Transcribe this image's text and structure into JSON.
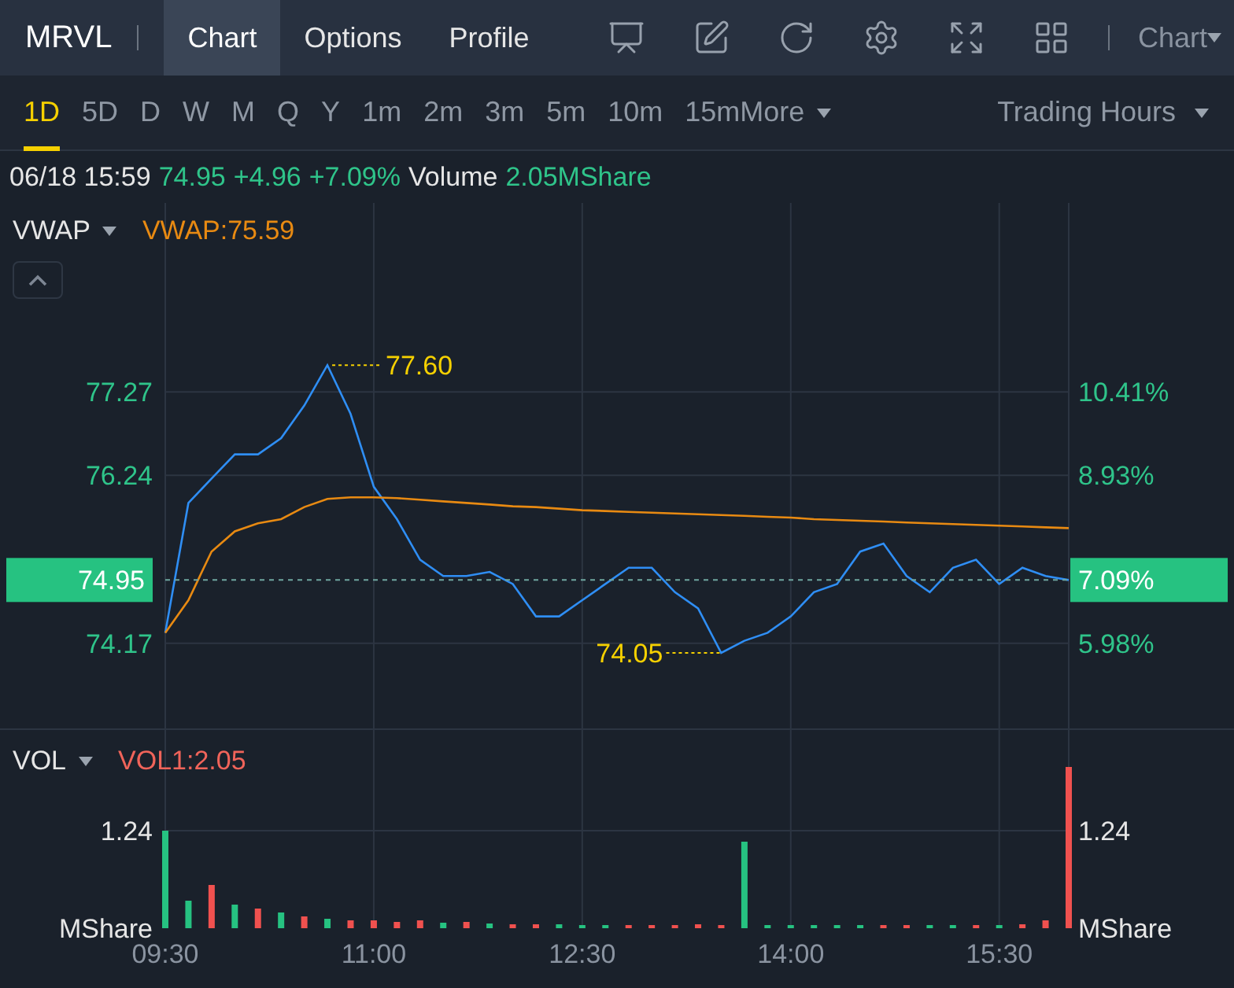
{
  "header": {
    "symbol": "MRVL",
    "tabs": [
      {
        "label": "Chart",
        "selected": true
      },
      {
        "label": "Options",
        "selected": false
      },
      {
        "label": "Profile",
        "selected": false
      }
    ],
    "chart_menu": "Chart"
  },
  "periods": [
    {
      "label": "1D",
      "selected": true
    },
    {
      "label": "5D",
      "selected": false
    },
    {
      "label": "D",
      "selected": false
    },
    {
      "label": "W",
      "selected": false
    },
    {
      "label": "M",
      "selected": false
    },
    {
      "label": "Q",
      "selected": false
    },
    {
      "label": "Y",
      "selected": false
    },
    {
      "label": "1m",
      "selected": false
    },
    {
      "label": "2m",
      "selected": false
    },
    {
      "label": "3m",
      "selected": false
    },
    {
      "label": "5m",
      "selected": false
    },
    {
      "label": "10m",
      "selected": false
    },
    {
      "label": "15m",
      "selected": false
    }
  ],
  "more": "More",
  "session": "Trading Hours",
  "quote": {
    "time": "06/18 15:59",
    "price": "74.95",
    "change": "+4.96",
    "change_pct": "+7.09%",
    "volume_label": "Volume",
    "volume": "2.05MShare"
  },
  "price_panel": {
    "indicator": "VWAP",
    "indicator_value": "VWAP:75.59",
    "last_price": {
      "percent": "7.09%"
    },
    "percent_ticks": [
      "10.41%",
      "8.93%",
      "5.98%"
    ],
    "chart_data": {
      "type": "line",
      "grid": true,
      "ref_lines": [
        {
          "axis": "y",
          "value": 74.95,
          "label": "74.95"
        }
      ],
      "ylim": [
        73.1,
        79.6
      ],
      "yticks": [
        {
          "value": 77.27,
          "label": "77.27"
        },
        {
          "value": 76.24,
          "label": "76.24"
        },
        {
          "value": 74.17,
          "label": "74.17"
        }
      ],
      "series": [
        {
          "color": "#2f8ef4",
          "values": [
            74.3,
            75.9,
            76.2,
            76.5,
            76.5,
            76.7,
            77.1,
            77.6,
            77.0,
            76.1,
            75.7,
            75.2,
            75.0,
            75.0,
            75.05,
            74.9,
            74.5,
            74.5,
            74.7,
            74.9,
            75.1,
            75.1,
            74.8,
            74.6,
            74.05,
            74.2,
            74.3,
            74.5,
            74.8,
            74.9,
            75.3,
            75.4,
            75.0,
            74.8,
            75.1,
            75.2,
            74.9,
            75.1,
            75.0,
            74.95
          ]
        },
        {
          "color": "#e88a12",
          "values": [
            74.3,
            74.7,
            75.3,
            75.55,
            75.65,
            75.7,
            75.85,
            75.95,
            75.97,
            75.97,
            75.96,
            75.94,
            75.92,
            75.9,
            75.88,
            75.86,
            75.85,
            75.83,
            75.81,
            75.8,
            75.79,
            75.78,
            75.77,
            75.76,
            75.75,
            75.74,
            75.73,
            75.72,
            75.7,
            75.69,
            75.68,
            75.67,
            75.66,
            75.65,
            75.64,
            75.63,
            75.62,
            75.61,
            75.6,
            75.59
          ]
        }
      ],
      "annotations": [
        "77.60",
        "74.05"
      ]
    }
  },
  "volume_panel": {
    "indicator": "VOL",
    "indicator_value": "VOL1:2.05",
    "right_ticks": [
      "1.24"
    ],
    "units": [
      "MShare",
      "MShare"
    ],
    "chart_data": {
      "type": "bar",
      "grid": true,
      "stacked": true,
      "categories": [
        "09:30",
        null,
        null,
        null,
        null,
        null,
        null,
        null,
        null,
        "11:00",
        null,
        null,
        null,
        null,
        null,
        null,
        null,
        null,
        "12:30",
        null,
        null,
        null,
        null,
        null,
        null,
        null,
        null,
        "14:00",
        null,
        null,
        null,
        null,
        null,
        null,
        null,
        null,
        "15:30",
        null,
        null,
        null
      ],
      "ylim": [
        0,
        2.52
      ],
      "yticks": [
        {
          "value": 1.24,
          "label": "1.24"
        }
      ],
      "series": [
        {
          "color": "#26c281",
          "values": [
            1.24,
            0.35,
            null,
            0.3,
            null,
            0.2,
            null,
            0.12,
            null,
            null,
            null,
            null,
            0.07,
            null,
            0.06,
            null,
            null,
            0.05,
            0.04,
            0.04,
            null,
            null,
            null,
            null,
            null,
            1.1,
            0.04,
            0.04,
            0.04,
            0.04,
            0.04,
            null,
            null,
            0.04,
            0.04,
            null,
            0.04,
            null,
            null,
            null
          ]
        },
        {
          "color": "#f0514f",
          "values": [
            null,
            null,
            0.55,
            null,
            0.25,
            null,
            0.15,
            null,
            0.1,
            0.1,
            0.08,
            0.1,
            null,
            0.08,
            null,
            0.05,
            0.05,
            null,
            null,
            null,
            0.04,
            0.04,
            0.04,
            0.05,
            0.04,
            null,
            null,
            null,
            null,
            null,
            null,
            0.04,
            0.04,
            null,
            null,
            0.04,
            null,
            0.05,
            0.1,
            2.05
          ]
        }
      ]
    }
  }
}
